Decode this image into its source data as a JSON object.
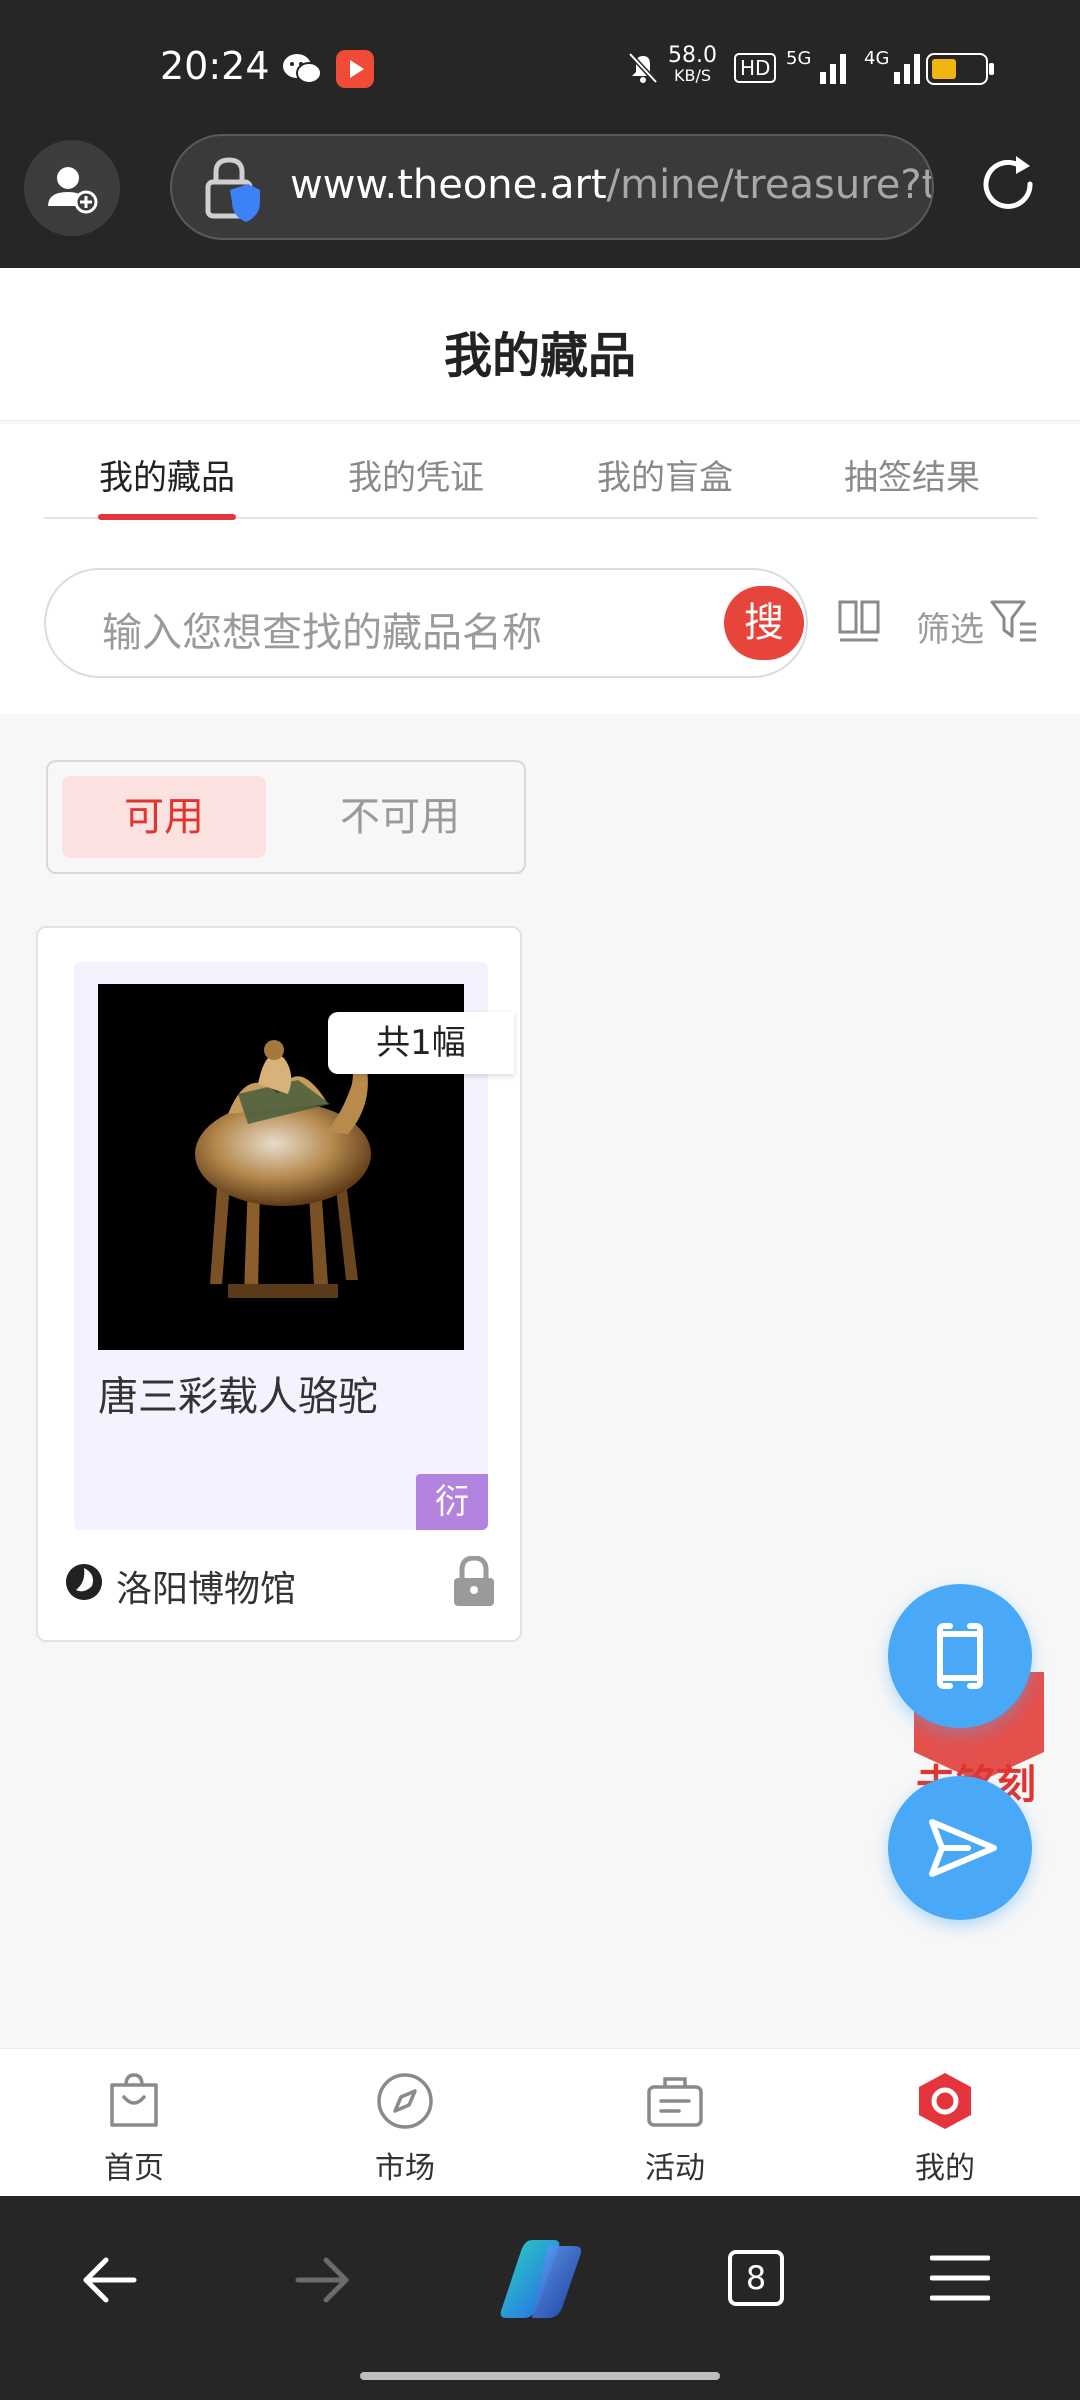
{
  "status_bar": {
    "time": "20:24",
    "speed_value": "58.0",
    "speed_unit": "KB/S",
    "hd_label": "HD",
    "net_5g": "5G",
    "net_4g": "4G",
    "battery_color": "#f2b40e"
  },
  "browser": {
    "url_host": "www.theone.art",
    "url_path": "/mine/treasure?tc",
    "tab_count": "8"
  },
  "page": {
    "title": "我的藏品"
  },
  "tabs": [
    {
      "label": "我的藏品",
      "active": true
    },
    {
      "label": "我的凭证",
      "active": false
    },
    {
      "label": "我的盲盒",
      "active": false
    },
    {
      "label": "抽签结果",
      "active": false
    }
  ],
  "search": {
    "placeholder": "输入您想查找的藏品名称",
    "button_label": "搜",
    "filter_label": "筛选"
  },
  "availability": {
    "available_label": "可用",
    "unavailable_label": "不可用"
  },
  "card": {
    "count_tag": "共1幅",
    "name": "唐三彩载人骆驼",
    "derive_badge": "衍",
    "museum": "洛阳博物馆"
  },
  "floating": {
    "engrave_text": "去铭刻"
  },
  "bottom_nav": [
    {
      "label": "首页",
      "icon": "bag-icon",
      "active": false
    },
    {
      "label": "市场",
      "icon": "compass-icon",
      "active": false
    },
    {
      "label": "活动",
      "icon": "briefcase-icon",
      "active": false
    },
    {
      "label": "我的",
      "icon": "profile-hex-icon",
      "active": true
    }
  ],
  "colors": {
    "accent_red": "#e5343b",
    "fab_blue": "#4aa9f6",
    "derive_purple": "#b383e0"
  }
}
